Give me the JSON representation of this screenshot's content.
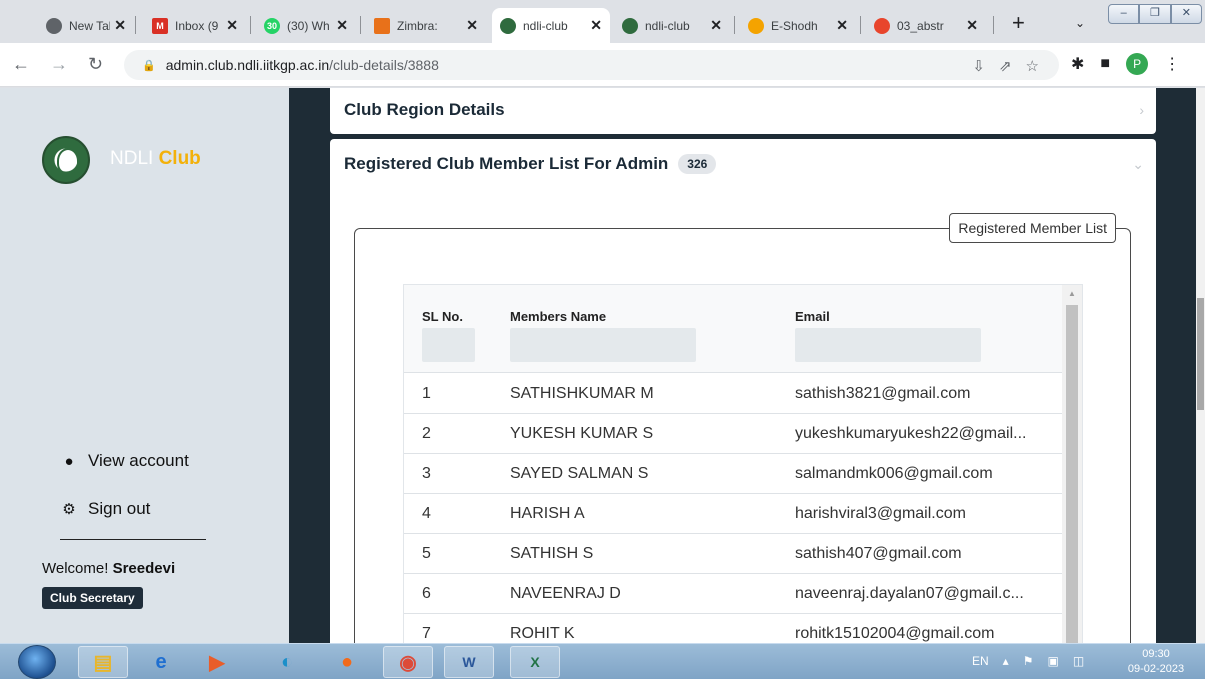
{
  "browser": {
    "tabs": [
      {
        "title": "New Tab",
        "icon": "chrome-icon",
        "color": "#5f6368",
        "active": false
      },
      {
        "title": "Inbox (9",
        "icon": "gmail-icon",
        "color": "#d93025",
        "active": false
      },
      {
        "title": "(30) Wh",
        "icon": "whatsapp-icon",
        "color": "#25d366",
        "active": false
      },
      {
        "title": "Zimbra:",
        "icon": "zimbra-icon",
        "color": "#e8711a",
        "active": false
      },
      {
        "title": "ndli-club",
        "icon": "ndli-icon",
        "color": "#2f6b3e",
        "active": true
      },
      {
        "title": "ndli-club",
        "icon": "ndli-icon",
        "color": "#2f6b3e",
        "active": false
      },
      {
        "title": "E-Shodh",
        "icon": "eshodh-icon",
        "color": "#f4a300",
        "active": false
      },
      {
        "title": "03_abstr",
        "icon": "pdf-icon",
        "color": "#e8452c",
        "active": false
      }
    ],
    "url_host": "admin.club.ndli.iitkgp.ac.in",
    "url_path": "/club-details/3888",
    "profile_initial": "P"
  },
  "sidebar": {
    "brand_main": "NDLI",
    "brand_accent": "Club",
    "links": [
      {
        "label": "View account",
        "icon": "user-icon"
      },
      {
        "label": "Sign out",
        "icon": "gear-icon"
      }
    ],
    "welcome_prefix": "Welcome!",
    "welcome_name": "Sreedevi",
    "role": "Club Secretary"
  },
  "main": {
    "region_title": "Club Region Details",
    "member_list_title": "Registered Club Member List For Admin",
    "member_count": "326",
    "fieldset_legend": "Registered Member List",
    "table": {
      "columns": [
        "SL No.",
        "Members Name",
        "Email"
      ],
      "rows": [
        {
          "sl": "1",
          "name": "SATHISHKUMAR M",
          "email": "sathish3821@gmail.com"
        },
        {
          "sl": "2",
          "name": "YUKESH KUMAR S",
          "email": "yukeshkumaryukesh22@gmail..."
        },
        {
          "sl": "3",
          "name": "SAYED SALMAN S",
          "email": "salmandmk006@gmail.com"
        },
        {
          "sl": "4",
          "name": "HARISH A",
          "email": "harishviral3@gmail.com"
        },
        {
          "sl": "5",
          "name": "SATHISH S",
          "email": "sathish407@gmail.com"
        },
        {
          "sl": "6",
          "name": "NAVEENRAJ D",
          "email": "naveenraj.dayalan07@gmail.c..."
        },
        {
          "sl": "7",
          "name": "ROHIT K",
          "email": "rohitk15102004@gmail.com"
        }
      ]
    }
  },
  "taskbar": {
    "lang": "EN",
    "time": "09:30",
    "date": "09-02-2023"
  },
  "colors": {
    "accent": "#f3b10a",
    "sidebar_bg": "#dce3e9",
    "page_bg": "#1e2c36"
  }
}
